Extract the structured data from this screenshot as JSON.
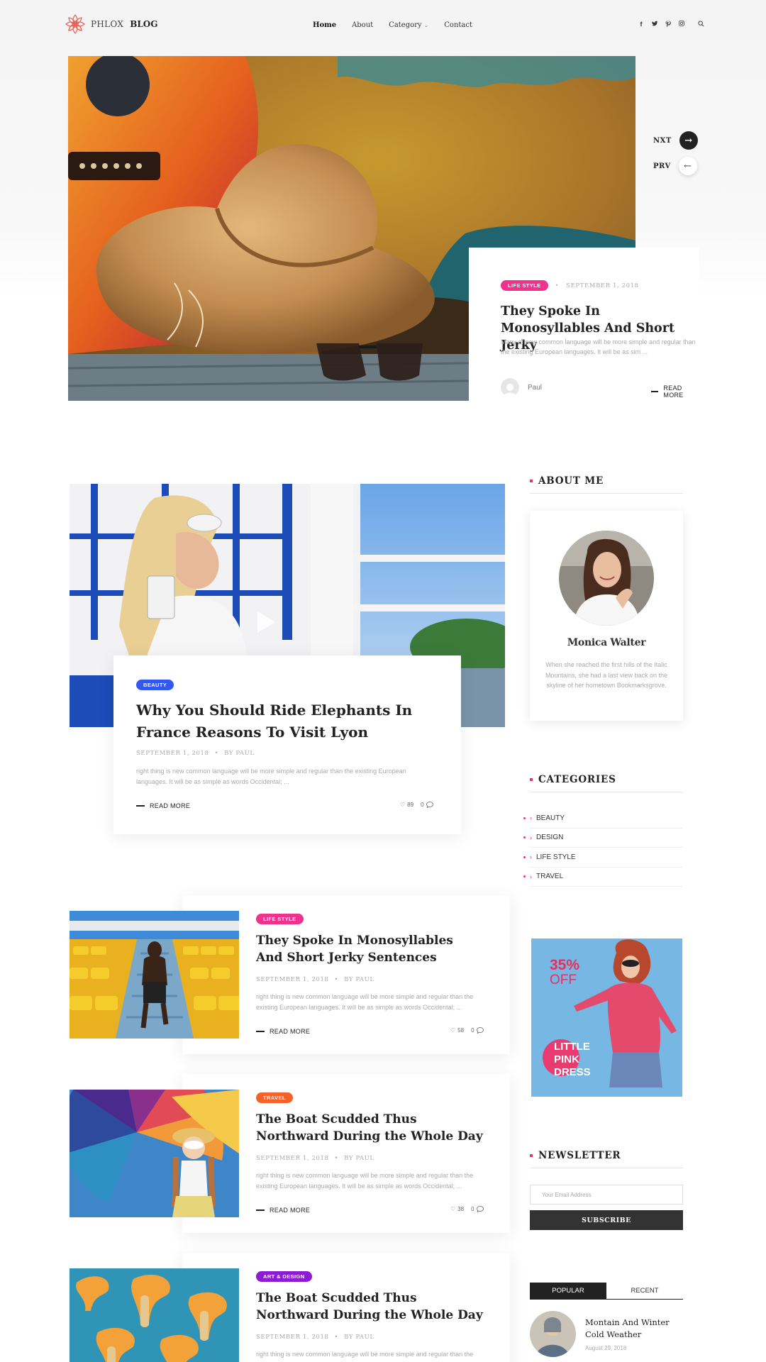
{
  "header": {
    "logo_light": "PHLOX",
    "logo_bold": "BLOG",
    "nav": [
      "Home",
      "About",
      "Category",
      "Contact"
    ],
    "social_icons": [
      "facebook-icon",
      "twitter-icon",
      "pinterest-icon",
      "instagram-icon",
      "search-icon"
    ]
  },
  "hero": {
    "next_label": "NXT",
    "prev_label": "PRV",
    "badge": "LIFE STYLE",
    "date": "SEPTEMBER 1, 2018",
    "title": "They Spoke In Monosyllables And Short Jerky",
    "excerpt": "Many of new common language will be more simple and regular than the existing European languages. It will be as sim ...",
    "author": "Paul",
    "read_more": "READ MORE"
  },
  "featured": {
    "badge": "BEAUTY",
    "title": "Why You Should Ride Elephants In France Reasons To Visit Lyon",
    "date": "SEPTEMBER 1, 2018",
    "by": "BY PAUL",
    "excerpt": "right thing is new common language will be more simple and regular than the existing European languages. It will be as simple as words Occidental; ...",
    "read_more": "READ MORE",
    "likes": "89",
    "comments": "0"
  },
  "posts": [
    {
      "badge": "LIFE STYLE",
      "badge_color": "#f0318d",
      "title": "They Spoke In Monosyllables And Short Jerky Sentences",
      "date": "SEPTEMBER 1, 2018",
      "by": "BY PAUL",
      "excerpt": "right thing is new common language will be more simple and regular than the existing European languages. It will be as simple as words Occidental; ...",
      "read_more": "READ MORE",
      "likes": "58",
      "comments": "0"
    },
    {
      "badge": "TRAVEL",
      "badge_color": "#f4622c",
      "title": "The Boat Scudded Thus Northward During the Whole Day",
      "date": "SEPTEMBER 1, 2018",
      "by": "BY PAUL",
      "excerpt": "right thing is new common language will be more simple and regular than the existing European languages. It will be as simple as words Occidental; ...",
      "read_more": "READ MORE",
      "likes": "38",
      "comments": "0"
    },
    {
      "badge": "ART & DESIGN",
      "badge_color": "#8d1bd4",
      "title": "The Boat Scudded Thus Northward During the Whole Day",
      "date": "SEPTEMBER 1, 2018",
      "by": "BY PAUL",
      "excerpt": "right thing is new common language will be more simple and regular than the"
    }
  ],
  "sidebar": {
    "about_title": "ABOUT ME",
    "about_name": "Monica Walter",
    "about_text": "When she reached the first hills of the Italic Mountains, she had a last view back on the skyline of her hometown Bookmarksgrove.",
    "categories_title": "CATEGORIES",
    "categories": [
      "BEAUTY",
      "DESIGN",
      "LIFE STYLE",
      "TRAVEL"
    ],
    "ad": {
      "percent": "35%",
      "off": "OFF",
      "line1": "LITTLE",
      "line2": "PINK",
      "line3": "DRESS"
    },
    "newsletter_title": "NEWSLETTER",
    "email_placeholder": "Your Email Address",
    "subscribe": "SUBSCRIBE",
    "tabs": [
      "POPULAR",
      "RECENT"
    ],
    "popular_post_title": "Montain And Winter Cold Weather",
    "popular_post_date": "August 29, 2018"
  }
}
